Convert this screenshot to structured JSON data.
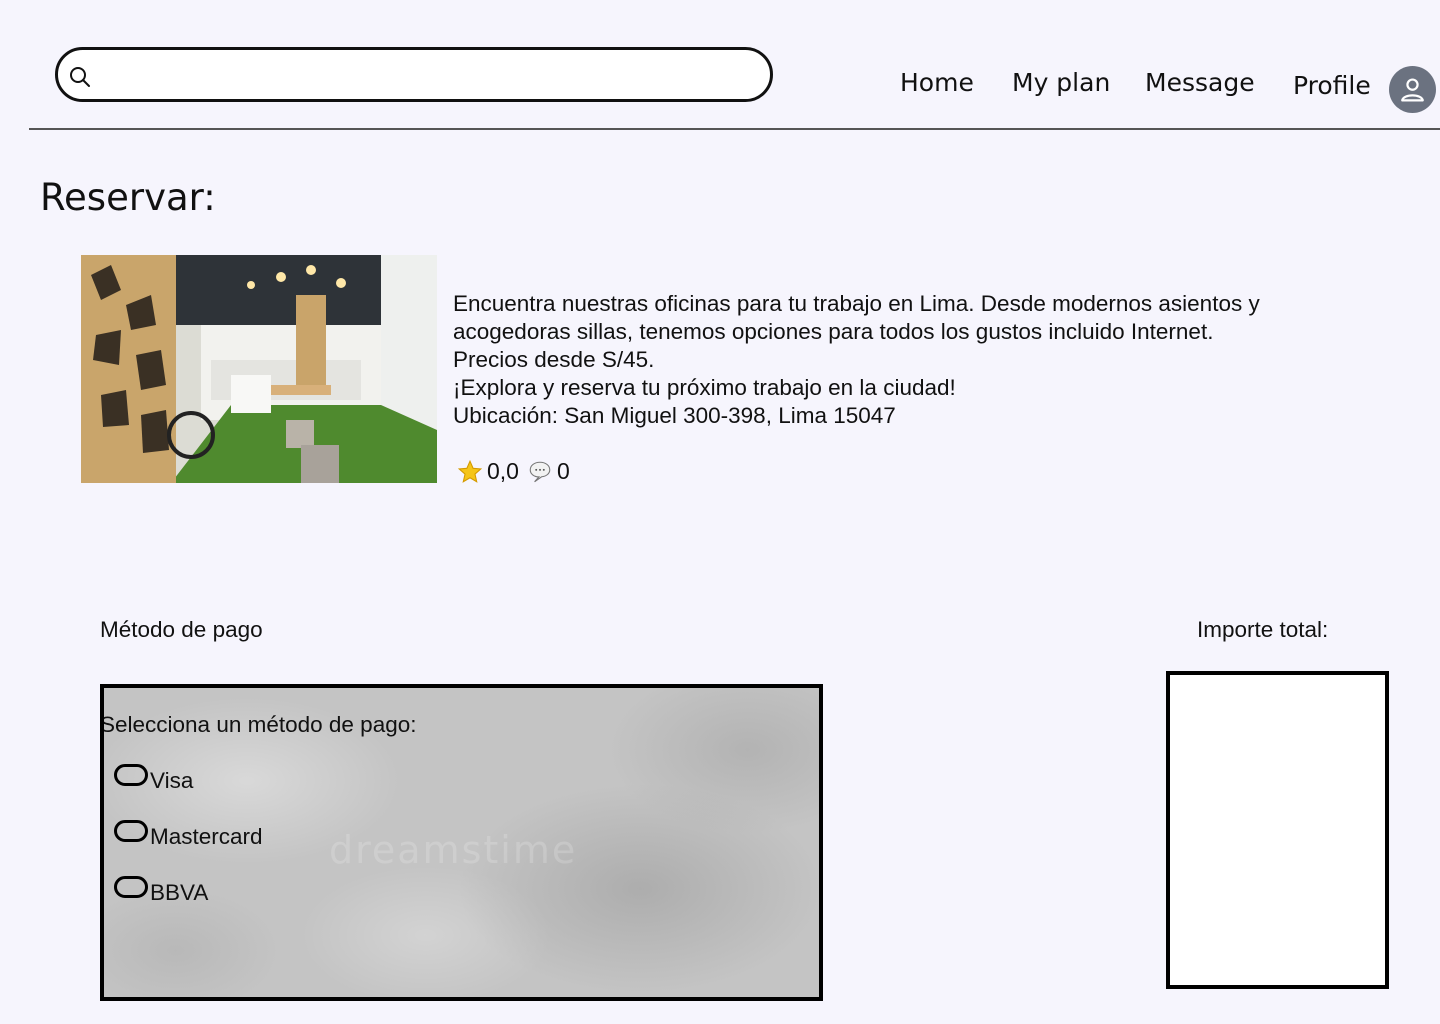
{
  "search": {
    "placeholder": "",
    "value": ""
  },
  "nav": {
    "home": "Home",
    "my_plan": "My plan",
    "message": "Message",
    "profile": "Profile"
  },
  "page": {
    "title": "Reservar:"
  },
  "listing": {
    "description_lines": [
      "Encuentra nuestras oficinas para tu trabajo en Lima. Desde modernos asientos y",
      "acogedoras sillas, tenemos opciones para todos los gustos incluido Internet.",
      "Precios desde S/45.",
      "¡Explora y reserva tu próximo trabajo en la ciudad!",
      "Ubicación: San Miguel 300-398, Lima 15047"
    ],
    "rating": "0,0",
    "comments": "0",
    "rating_icon": "star-icon",
    "comment_icon": "speech-bubble-icon"
  },
  "payment": {
    "label": "Método de pago",
    "prompt": "Selecciona un método de pago:",
    "options": [
      "Visa",
      "Mastercard",
      "BBVA"
    ],
    "watermark": "dreamstime"
  },
  "total": {
    "label": "Importe total:",
    "value": ""
  },
  "colors": {
    "background": "#f6f5fd",
    "avatar": "#6b7280",
    "star": "#f5c518"
  }
}
